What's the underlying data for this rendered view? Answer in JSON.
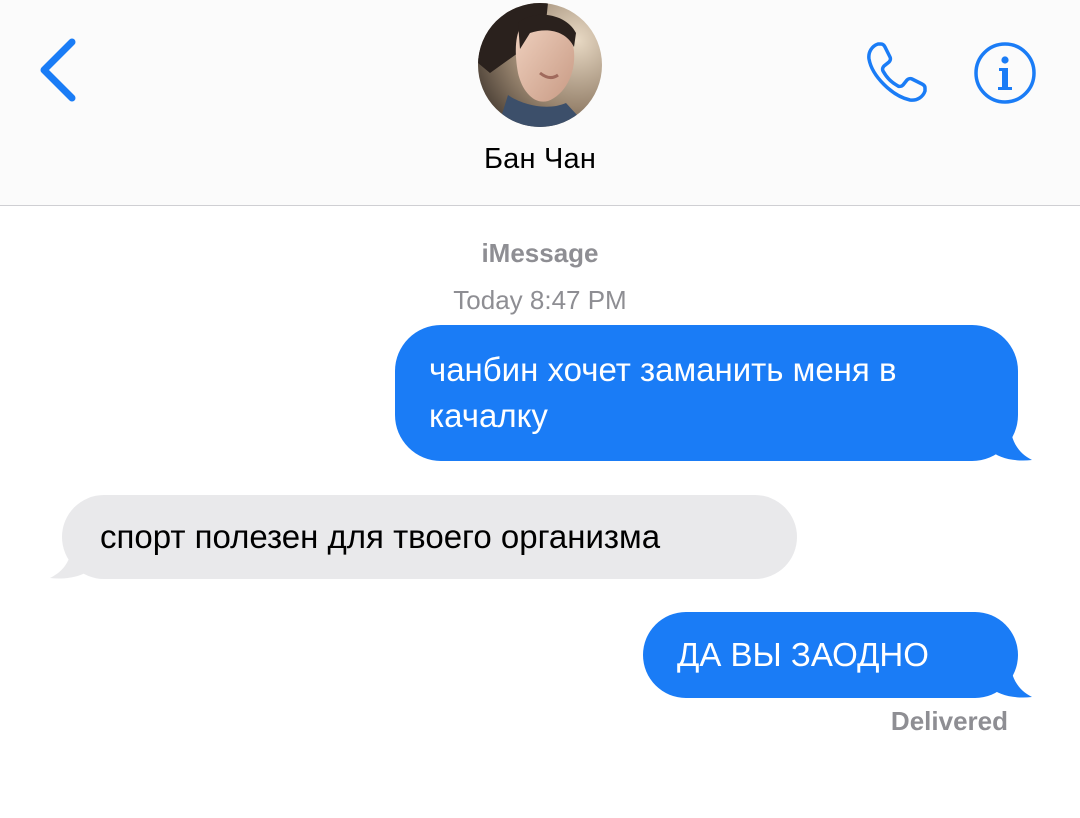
{
  "header": {
    "contact_name": "Бан Чан",
    "back_icon": "chevron-left-icon",
    "call_icon": "phone-icon",
    "info_icon": "info-icon"
  },
  "thread": {
    "service": "iMessage",
    "timestamp": "Today 8:47 PM",
    "messages": [
      {
        "direction": "outgoing",
        "text": "чанбин хочет заманить меня в качалку"
      },
      {
        "direction": "incoming",
        "text": "спорт полезен для твоего организма"
      },
      {
        "direction": "outgoing",
        "text": "ДА ВЫ ЗАОДНО"
      }
    ],
    "status": "Delivered"
  },
  "colors": {
    "accent": "#1a7cf6",
    "incoming_bubble": "#e9e9eb",
    "meta_text": "#8e8e93"
  }
}
